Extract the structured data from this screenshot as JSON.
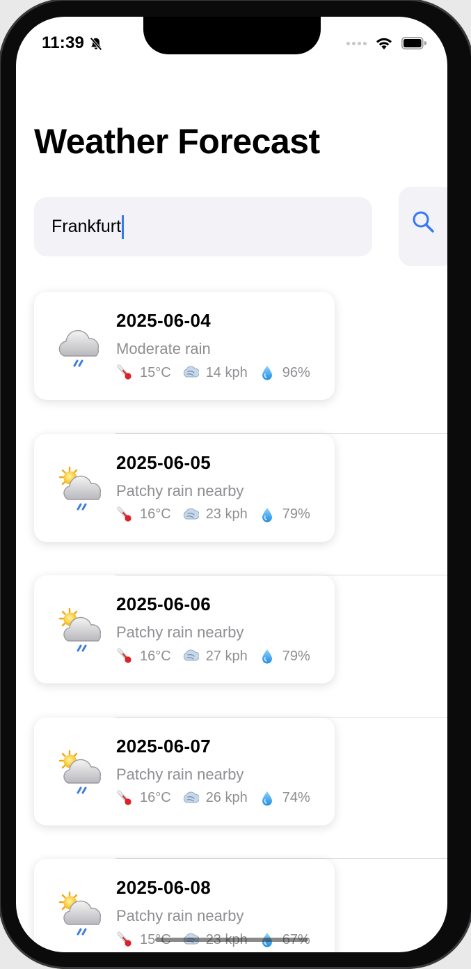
{
  "status_bar": {
    "time": "11:39",
    "icons": [
      "bell-slash-icon",
      "signal-dots-icon",
      "wifi-icon",
      "battery-icon"
    ]
  },
  "header": {
    "title": "Weather Forecast"
  },
  "search": {
    "value": "Frankfurt",
    "button_icon": "search-icon"
  },
  "colors": {
    "accent": "#3478F6",
    "secondary_text": "#8E8E93",
    "field_background": "#F2F2F7"
  },
  "forecast": [
    {
      "date": "2025-06-04",
      "condition": "Moderate rain",
      "icon": "rain-cloud-icon",
      "temperature": "15°C",
      "wind": "14 kph",
      "humidity": "96%"
    },
    {
      "date": "2025-06-05",
      "condition": "Patchy rain nearby",
      "icon": "sun-rain-cloud-icon",
      "temperature": "16°C",
      "wind": "23 kph",
      "humidity": "79%"
    },
    {
      "date": "2025-06-06",
      "condition": "Patchy rain nearby",
      "icon": "sun-rain-cloud-icon",
      "temperature": "16°C",
      "wind": "27 kph",
      "humidity": "79%"
    },
    {
      "date": "2025-06-07",
      "condition": "Patchy rain nearby",
      "icon": "sun-rain-cloud-icon",
      "temperature": "16°C",
      "wind": "26 kph",
      "humidity": "74%"
    },
    {
      "date": "2025-06-08",
      "condition": "Patchy rain nearby",
      "icon": "sun-rain-cloud-icon",
      "temperature": "15°C",
      "wind": "23 kph",
      "humidity": "67%"
    }
  ]
}
